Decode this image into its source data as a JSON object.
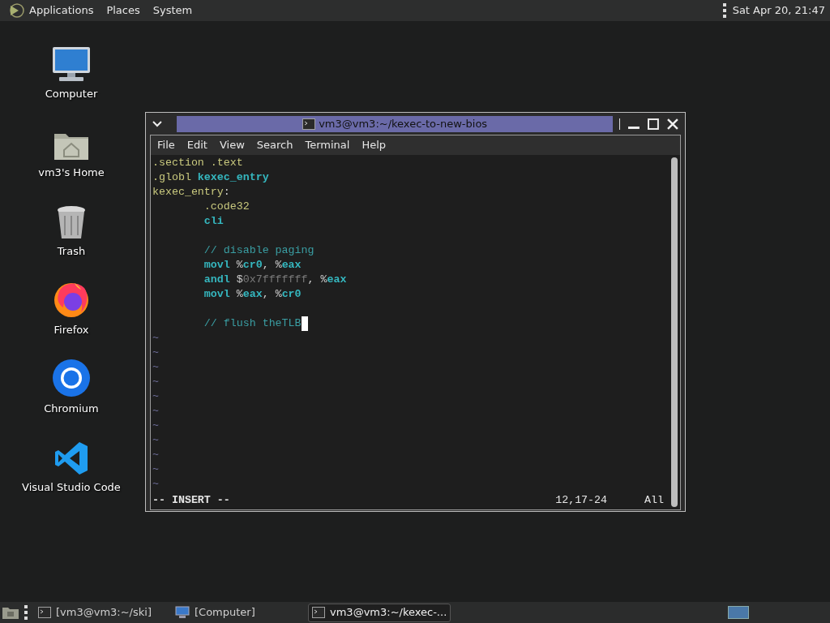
{
  "top_panel": {
    "menus": [
      "Applications",
      "Places",
      "System"
    ],
    "clock": "Sat Apr 20, 21:47"
  },
  "desktop_icons": [
    {
      "label": "Computer",
      "kind": "computer"
    },
    {
      "label": "vm3's Home",
      "kind": "home"
    },
    {
      "label": "Trash",
      "kind": "trash"
    },
    {
      "label": "Firefox",
      "kind": "firefox"
    },
    {
      "label": "Chromium",
      "kind": "chromium"
    },
    {
      "label": "Visual Studio Code",
      "kind": "vscode"
    }
  ],
  "window": {
    "title": "vm3@vm3:~/kexec-to-new-bios",
    "menus": [
      "File",
      "Edit",
      "View",
      "Search",
      "Terminal",
      "Help"
    ],
    "editor": {
      "lines": [
        {
          "cursor": false,
          "segments": [
            {
              "kind": "directive",
              "text": ".section .text"
            }
          ]
        },
        {
          "cursor": false,
          "segments": [
            {
              "kind": "directive",
              "text": ".globl "
            },
            {
              "kind": "keyword",
              "text": "kexec_entry"
            }
          ]
        },
        {
          "cursor": false,
          "segments": [
            {
              "kind": "directive",
              "text": "kexec_entry"
            },
            {
              "kind": "plain",
              "text": ":"
            }
          ]
        },
        {
          "cursor": false,
          "segments": [
            {
              "kind": "directive",
              "text": "        .code32"
            }
          ]
        },
        {
          "cursor": false,
          "segments": [
            {
              "kind": "keyword",
              "text": "        cli"
            }
          ]
        },
        {
          "cursor": false
        },
        {
          "cursor": false,
          "segments": [
            {
              "kind": "comment",
              "text": "        // disable paging"
            }
          ]
        },
        {
          "cursor": false,
          "segments": [
            {
              "kind": "keyword",
              "text": "        movl "
            },
            {
              "kind": "plain",
              "text": "%"
            },
            {
              "kind": "keyword",
              "text": "cr0"
            },
            {
              "kind": "plain",
              "text": ", %"
            },
            {
              "kind": "keyword",
              "text": "eax"
            }
          ]
        },
        {
          "cursor": false,
          "segments": [
            {
              "kind": "keyword",
              "text": "        andl "
            },
            {
              "kind": "plain",
              "text": "$"
            },
            {
              "kind": "number",
              "text": "0x7fffffff"
            },
            {
              "kind": "plain",
              "text": ", %"
            },
            {
              "kind": "keyword",
              "text": "eax"
            }
          ]
        },
        {
          "cursor": false,
          "segments": [
            {
              "kind": "keyword",
              "text": "        movl "
            },
            {
              "kind": "plain",
              "text": "%"
            },
            {
              "kind": "keyword",
              "text": "eax"
            },
            {
              "kind": "plain",
              "text": ", %"
            },
            {
              "kind": "keyword",
              "text": "cr0"
            }
          ]
        },
        {
          "cursor": false
        },
        {
          "cursor": true,
          "segments": [
            {
              "kind": "comment",
              "text": "        // flush theTLB"
            }
          ]
        }
      ],
      "empty_line_markers": [
        "~",
        "~",
        "~",
        "~",
        "~",
        "~",
        "~",
        "~",
        "~",
        "~",
        "~"
      ],
      "mode": "-- INSERT --",
      "position": "12,17-24",
      "scroll": "All"
    }
  },
  "taskbar": {
    "items": [
      {
        "label": "[vm3@vm3:~/ski]",
        "kind": "terminal",
        "selected": false
      },
      {
        "label": "[Computer]",
        "kind": "computer",
        "selected": false
      },
      {
        "label": "vm3@vm3:~/kexec-...",
        "kind": "terminal",
        "selected": true
      }
    ]
  }
}
